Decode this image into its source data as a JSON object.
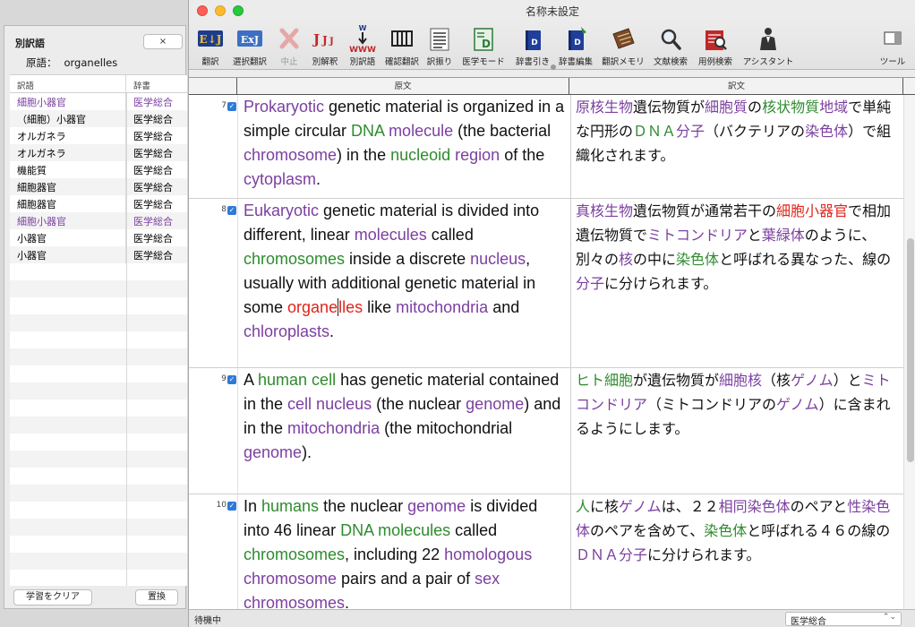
{
  "side_panel": {
    "title": "別訳語",
    "close_label": "×",
    "original_label": "原語：",
    "original_word": "organelles",
    "col_translation": "訳語",
    "col_dictionary": "辞書",
    "rows": [
      {
        "term": "細胞小器官",
        "dict": "医学総合",
        "highlight": true
      },
      {
        "term": "（細胞）小器官",
        "dict": "医学総合",
        "highlight": false
      },
      {
        "term": "オルガネラ",
        "dict": "医学総合",
        "highlight": false
      },
      {
        "term": "オルガネラ",
        "dict": "医学総合",
        "highlight": false
      },
      {
        "term": "機能質",
        "dict": "医学総合",
        "highlight": false
      },
      {
        "term": "細胞器官",
        "dict": "医学総合",
        "highlight": false
      },
      {
        "term": "細胞器官",
        "dict": "医学総合",
        "highlight": false
      },
      {
        "term": "細胞小器官",
        "dict": "医学総合",
        "highlight": true
      },
      {
        "term": "小器官",
        "dict": "医学総合",
        "highlight": false
      },
      {
        "term": "小器官",
        "dict": "医学総合",
        "highlight": false
      }
    ],
    "clear_learning_label": "学習をクリア",
    "replace_label": "置換"
  },
  "window": {
    "title": "名称未設定"
  },
  "toolbar": [
    {
      "id": "translate",
      "label": "翻訳",
      "icon": "ej-translate-icon",
      "disabled": false
    },
    {
      "id": "select-translate",
      "label": "選択翻訳",
      "icon": "ej-select-translate-icon",
      "disabled": false
    },
    {
      "id": "stop",
      "label": "中止",
      "icon": "stop-x-icon",
      "disabled": true
    },
    {
      "id": "alt-interpret",
      "label": "別解釈",
      "icon": "alt-interpretation-icon",
      "disabled": false
    },
    {
      "id": "alt-word",
      "label": "別訳語",
      "icon": "alternative-words-icon",
      "disabled": false
    },
    {
      "id": "confirm",
      "label": "確認翻訳",
      "icon": "confirm-translate-icon",
      "disabled": false
    },
    {
      "id": "ruby",
      "label": "訳振り",
      "icon": "interlinear-icon",
      "disabled": false
    },
    {
      "id": "medical",
      "label": "医学モード",
      "icon": "medical-dictionary-icon",
      "disabled": false
    },
    {
      "id": "dict-lookup",
      "label": "辞書引き",
      "icon": "dictionary-lookup-icon",
      "disabled": false
    },
    {
      "id": "dict-edit",
      "label": "辞書編集",
      "icon": "dictionary-edit-icon",
      "disabled": false
    },
    {
      "id": "memory",
      "label": "翻訳メモリ",
      "icon": "translation-memory-icon",
      "disabled": false
    },
    {
      "id": "doc-search",
      "label": "文献検索",
      "icon": "magnifier-icon",
      "disabled": false
    },
    {
      "id": "example-search",
      "label": "用例検索",
      "icon": "example-search-icon",
      "disabled": false
    },
    {
      "id": "assistant",
      "label": "アシスタント",
      "icon": "assistant-icon",
      "disabled": false
    },
    {
      "id": "tools",
      "label": "ツール",
      "icon": "sidebar-toggle-icon",
      "disabled": false
    }
  ],
  "columns": {
    "source": "原文",
    "target": "訳文"
  },
  "sentences": [
    {
      "number": "7",
      "source": [
        {
          "t": "Prokaryotic",
          "c": "p"
        },
        {
          "t": " genetic material is organized in a simple circular "
        },
        {
          "t": "DNA",
          "c": "g"
        },
        {
          "t": " "
        },
        {
          "t": "molecule",
          "c": "p"
        },
        {
          "t": " (the bacterial "
        },
        {
          "t": "chromosome",
          "c": "p"
        },
        {
          "t": ") in the "
        },
        {
          "t": "nucleoid",
          "c": "g"
        },
        {
          "t": " "
        },
        {
          "t": "region",
          "c": "p"
        },
        {
          "t": " of the "
        },
        {
          "t": "cytoplasm",
          "c": "p"
        },
        {
          "t": "."
        }
      ],
      "target": [
        {
          "t": "原核生物",
          "c": "p"
        },
        {
          "t": "遺伝物質が"
        },
        {
          "t": "細胞質",
          "c": "p"
        },
        {
          "t": "の"
        },
        {
          "t": "核状物質",
          "c": "g"
        },
        {
          "t": "地域",
          "c": "p"
        },
        {
          "t": "で単純な円形の"
        },
        {
          "t": "ＤＮＡ",
          "c": "g"
        },
        {
          "t": "分子",
          "c": "p"
        },
        {
          "t": "（バクテリアの"
        },
        {
          "t": "染色体",
          "c": "p"
        },
        {
          "t": "）で組織化されます。"
        }
      ]
    },
    {
      "number": "8",
      "source": [
        {
          "t": "Eukaryotic",
          "c": "p"
        },
        {
          "t": " genetic material is divided into different, linear "
        },
        {
          "t": "molecules",
          "c": "p"
        },
        {
          "t": " called "
        },
        {
          "t": "chromosomes",
          "c": "g"
        },
        {
          "t": " inside a discrete "
        },
        {
          "t": "nucleus",
          "c": "p"
        },
        {
          "t": ", usually with additional genetic material in some "
        },
        {
          "t": "organe",
          "c": "r"
        },
        {
          "t": "",
          "caret": true
        },
        {
          "t": "lles",
          "c": "r"
        },
        {
          "t": " like "
        },
        {
          "t": "mitochondria",
          "c": "p"
        },
        {
          "t": " and "
        },
        {
          "t": "chloroplasts",
          "c": "p"
        },
        {
          "t": "."
        }
      ],
      "target": [
        {
          "t": "真核生物",
          "c": "p"
        },
        {
          "t": "遺伝物質が通常若干の"
        },
        {
          "t": "細胞小器官",
          "c": "r"
        },
        {
          "t": "で相加遺伝物質で"
        },
        {
          "t": "ミトコンドリア",
          "c": "p"
        },
        {
          "t": "と"
        },
        {
          "t": "葉緑体",
          "c": "p"
        },
        {
          "t": "のように、別々の"
        },
        {
          "t": "核",
          "c": "p"
        },
        {
          "t": "の中に"
        },
        {
          "t": "染色体",
          "c": "g"
        },
        {
          "t": "と呼ばれる異なった、線の"
        },
        {
          "t": "分子",
          "c": "p"
        },
        {
          "t": "に分けられます。"
        }
      ]
    },
    {
      "number": "9",
      "source": [
        {
          "t": "A "
        },
        {
          "t": "human cell",
          "c": "g"
        },
        {
          "t": " has genetic material contained in the "
        },
        {
          "t": "cell nucleus",
          "c": "p"
        },
        {
          "t": " (the nuclear "
        },
        {
          "t": "genome",
          "c": "p"
        },
        {
          "t": ") and in the "
        },
        {
          "t": "mitochondria",
          "c": "p"
        },
        {
          "t": " (the mitochondrial "
        },
        {
          "t": "genome",
          "c": "p"
        },
        {
          "t": ")."
        }
      ],
      "target": [
        {
          "t": "ヒト細胞",
          "c": "g"
        },
        {
          "t": "が遺伝物質が"
        },
        {
          "t": "細胞核",
          "c": "p"
        },
        {
          "t": "（核"
        },
        {
          "t": "ゲノム",
          "c": "p"
        },
        {
          "t": "）と"
        },
        {
          "t": "ミトコンドリア",
          "c": "p"
        },
        {
          "t": "（ミトコンドリアの"
        },
        {
          "t": "ゲノム",
          "c": "p"
        },
        {
          "t": "）に含まれるようにします。"
        }
      ]
    },
    {
      "number": "10",
      "source": [
        {
          "t": "In "
        },
        {
          "t": "humans",
          "c": "g"
        },
        {
          "t": " the nuclear "
        },
        {
          "t": "genome",
          "c": "p"
        },
        {
          "t": " is divided into 46 linear "
        },
        {
          "t": "DNA molecules",
          "c": "g"
        },
        {
          "t": " called "
        },
        {
          "t": "chromosomes",
          "c": "g"
        },
        {
          "t": ", including 22 "
        },
        {
          "t": "homologous chromosome",
          "c": "p"
        },
        {
          "t": " pairs and a pair of "
        },
        {
          "t": "sex",
          "c": "p"
        },
        {
          "t": " "
        },
        {
          "t": "chromosomes",
          "c": "p"
        },
        {
          "t": "."
        }
      ],
      "target": [
        {
          "t": "人",
          "c": "g"
        },
        {
          "t": "に核"
        },
        {
          "t": "ゲノム",
          "c": "p"
        },
        {
          "t": "は、２２"
        },
        {
          "t": "相同染色体",
          "c": "p"
        },
        {
          "t": "のペアと"
        },
        {
          "t": "性染色体",
          "c": "p"
        },
        {
          "t": "のペアを含めて、"
        },
        {
          "t": "染色体",
          "c": "g"
        },
        {
          "t": "と呼ばれる４６の線の"
        },
        {
          "t": "ＤＮＡ分子",
          "c": "p"
        },
        {
          "t": "に分けられます。"
        }
      ]
    }
  ],
  "status": {
    "text": "待機中",
    "dictionary_select": "医学総合"
  }
}
